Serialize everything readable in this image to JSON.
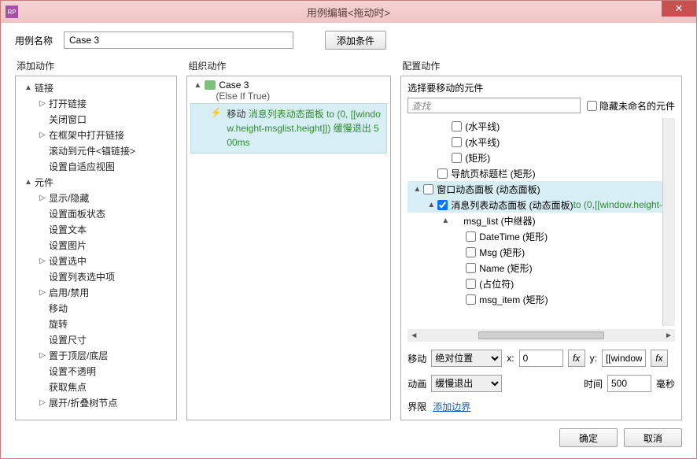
{
  "window": {
    "title": "用例编辑<拖动时>",
    "app_icon_text": "RP"
  },
  "top": {
    "name_label": "用例名称",
    "name_value": "Case 3",
    "add_condition": "添加条件"
  },
  "columns": {
    "left": "添加动作",
    "mid": "组织动作",
    "right": "配置动作"
  },
  "actions_tree": [
    {
      "indent": 0,
      "tw": "▲",
      "label": "链接"
    },
    {
      "indent": 1,
      "tw": "▷",
      "label": "打开链接"
    },
    {
      "indent": 1,
      "tw": "",
      "label": "关闭窗口"
    },
    {
      "indent": 1,
      "tw": "▷",
      "label": "在框架中打开链接"
    },
    {
      "indent": 1,
      "tw": "",
      "label": "滚动到元件<锚链接>"
    },
    {
      "indent": 1,
      "tw": "",
      "label": "设置自适应视图"
    },
    {
      "indent": 0,
      "tw": "▲",
      "label": "元件"
    },
    {
      "indent": 1,
      "tw": "▷",
      "label": "显示/隐藏"
    },
    {
      "indent": 1,
      "tw": "",
      "label": "设置面板状态"
    },
    {
      "indent": 1,
      "tw": "",
      "label": "设置文本"
    },
    {
      "indent": 1,
      "tw": "",
      "label": "设置图片"
    },
    {
      "indent": 1,
      "tw": "▷",
      "label": "设置选中"
    },
    {
      "indent": 1,
      "tw": "",
      "label": "设置列表选中项"
    },
    {
      "indent": 1,
      "tw": "▷",
      "label": "启用/禁用"
    },
    {
      "indent": 1,
      "tw": "",
      "label": "移动"
    },
    {
      "indent": 1,
      "tw": "",
      "label": "旋转"
    },
    {
      "indent": 1,
      "tw": "",
      "label": "设置尺寸"
    },
    {
      "indent": 1,
      "tw": "▷",
      "label": "置于顶层/底层"
    },
    {
      "indent": 1,
      "tw": "",
      "label": "设置不透明"
    },
    {
      "indent": 1,
      "tw": "",
      "label": "获取焦点"
    },
    {
      "indent": 1,
      "tw": "▷",
      "label": "展开/折叠树节点"
    }
  ],
  "organize": {
    "case_label": "Case 3",
    "case_sub": "(Else If True)",
    "action_kw": "移动",
    "action_green1": "消息列表动态面板 to (0,",
    "action_green2": "[[window.height-msglist.height]])",
    "action_green3": "缓慢退出",
    "action_green4": "500ms"
  },
  "config": {
    "select_widget_label": "选择要移动的元件",
    "search_placeholder": "查找",
    "hide_unnamed": "隐藏未命名的元件",
    "tree": [
      {
        "indent": 2,
        "tw": "",
        "cb": false,
        "text": "(水平线)"
      },
      {
        "indent": 2,
        "tw": "",
        "cb": false,
        "text": "(水平线)"
      },
      {
        "indent": 2,
        "tw": "",
        "cb": false,
        "text": "(矩形)"
      },
      {
        "indent": 1,
        "tw": "",
        "cb": false,
        "text": "导航页标题栏 (矩形)"
      },
      {
        "indent": 0,
        "tw": "▲",
        "cb": false,
        "text": "窗口动态面板 (动态面板)",
        "sel": true
      },
      {
        "indent": 1,
        "tw": "▲",
        "cb": true,
        "text": "消息列表动态面板 (动态面板)",
        "suffix": " to (0,[[window.height-",
        "sel": true
      },
      {
        "indent": 2,
        "tw": "▲",
        "cb": null,
        "text": "msg_list (中继器)"
      },
      {
        "indent": 3,
        "tw": "",
        "cb": false,
        "text": "DateTime (矩形)"
      },
      {
        "indent": 3,
        "tw": "",
        "cb": false,
        "text": "Msg (矩形)"
      },
      {
        "indent": 3,
        "tw": "",
        "cb": false,
        "text": "Name (矩形)"
      },
      {
        "indent": 3,
        "tw": "",
        "cb": false,
        "text": "(占位符)"
      },
      {
        "indent": 3,
        "tw": "",
        "cb": false,
        "text": "msg_item (矩形)"
      }
    ],
    "move_label": "移动",
    "move_type": "绝对位置",
    "x_label": "x:",
    "x_value": "0",
    "y_label": "y:",
    "y_value": "[[window",
    "fx": "fx",
    "anim_label": "动画",
    "anim_type": "缓慢退出",
    "time_label": "时间",
    "time_value": "500",
    "time_unit": "毫秒",
    "bounds_label": "界限",
    "bounds_link": "添加边界"
  },
  "footer": {
    "ok": "确定",
    "cancel": "取消"
  }
}
